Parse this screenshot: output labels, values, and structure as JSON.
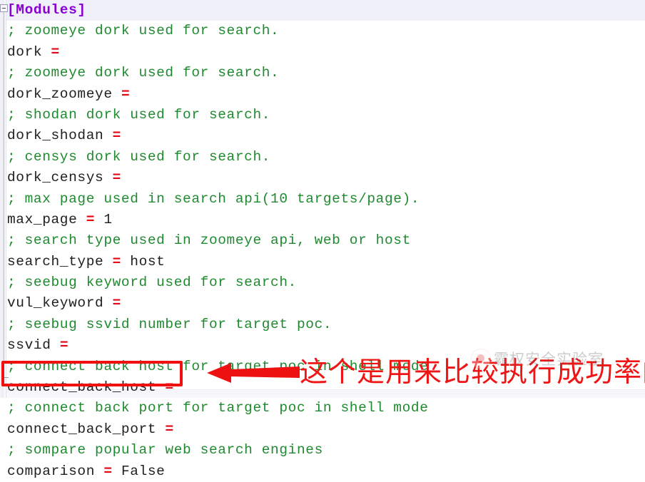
{
  "editor": {
    "section_header": "[Modules]",
    "fold_marker": "fold-collapse-box",
    "lines": [
      {
        "kind": "comment",
        "text": "; zoomeye dork used for search."
      },
      {
        "kind": "kv",
        "key": "dork",
        "eq": "=",
        "value": ""
      },
      {
        "kind": "comment",
        "text": "; zoomeye dork used for search."
      },
      {
        "kind": "kv",
        "key": "dork_zoomeye",
        "eq": "=",
        "value": ""
      },
      {
        "kind": "comment",
        "text": "; shodan dork used for search."
      },
      {
        "kind": "kv",
        "key": "dork_shodan",
        "eq": "=",
        "value": ""
      },
      {
        "kind": "comment",
        "text": "; censys dork used for search."
      },
      {
        "kind": "kv",
        "key": "dork_censys",
        "eq": "=",
        "value": ""
      },
      {
        "kind": "comment",
        "text": "; max page used in search api(10 targets/page)."
      },
      {
        "kind": "kv",
        "key": "max_page",
        "eq": "=",
        "value": "1"
      },
      {
        "kind": "comment",
        "text": "; search type used in zoomeye api, web or host"
      },
      {
        "kind": "kv",
        "key": "search_type",
        "eq": "=",
        "value": "host"
      },
      {
        "kind": "comment",
        "text": "; seebug keyword used for search."
      },
      {
        "kind": "kv",
        "key": "vul_keyword",
        "eq": "=",
        "value": ""
      },
      {
        "kind": "comment",
        "text": "; seebug ssvid number for target poc."
      },
      {
        "kind": "kv",
        "key": "ssvid",
        "eq": "=",
        "value": ""
      },
      {
        "kind": "comment",
        "text": "; connect back host for target poc in shell mode"
      },
      {
        "kind": "kv",
        "key": "connect_back_host",
        "eq": "=",
        "value": ""
      },
      {
        "kind": "comment",
        "text": "; connect back port for target poc in shell mode"
      },
      {
        "kind": "kv",
        "key": "connect_back_port",
        "eq": "=",
        "value": ""
      },
      {
        "kind": "comment",
        "text": "; sompare popular web search engines"
      },
      {
        "kind": "kv",
        "key": "comparison",
        "eq": "=",
        "value": "False"
      }
    ]
  },
  "annotation": {
    "highlight_target": "comparison = False",
    "arrow_direction": "left",
    "note_text": "这个是用来比较执行成功率的",
    "note_color": "#f01515",
    "box_color": "#f01010"
  },
  "watermark": {
    "logo": "circle-logo-icon",
    "text": "霸权安全实验室"
  },
  "colors": {
    "section_text": "#8a00d4",
    "section_background": "#f0f0fb",
    "comment": "#1f8a2f",
    "key": "#202020",
    "equals": "#e60012",
    "value": "#202020",
    "page_background": "#ffffff"
  }
}
